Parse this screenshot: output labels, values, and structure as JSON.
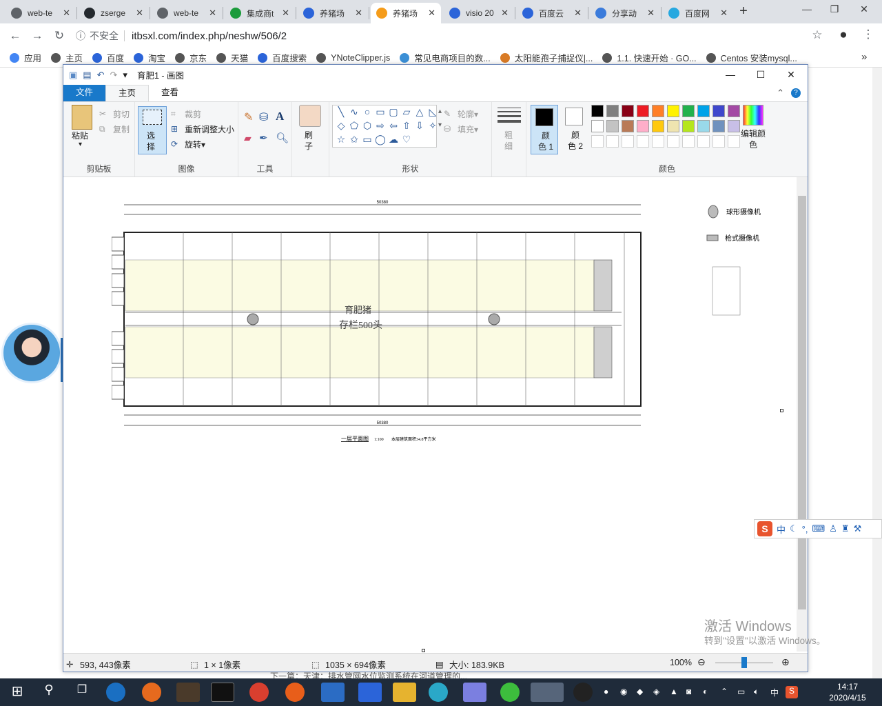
{
  "browser": {
    "tabs": [
      {
        "title": "web-te",
        "color": "#5f6368",
        "active": false
      },
      {
        "title": "zserge",
        "color": "#24292e",
        "active": false
      },
      {
        "title": "web-te",
        "color": "#5f6368",
        "active": false
      },
      {
        "title": "集成商t",
        "color": "#1b9b3b",
        "active": false
      },
      {
        "title": "养猪场",
        "color": "#2b64d9",
        "active": false
      },
      {
        "title": "养猪场",
        "color": "#f59c1a",
        "active": true,
        "prefix": "XL"
      },
      {
        "title": "visio 20",
        "color": "#2b64d9",
        "active": false
      },
      {
        "title": "百度云",
        "color": "#2b64d9",
        "active": false
      },
      {
        "title": "分享动",
        "color": "#3b7bdb",
        "active": false
      },
      {
        "title": "百度网",
        "color": "#26a8e0",
        "active": false
      }
    ],
    "insecure_label": "不安全",
    "url": "itbsxl.com/index.php/neshw/506/2",
    "bookmarks": [
      {
        "label": "应用",
        "color": "#4285f4"
      },
      {
        "label": "主页",
        "color": "#555"
      },
      {
        "label": "百度",
        "color": "#2b64d9"
      },
      {
        "label": "淘宝",
        "color": "#2b64d9"
      },
      {
        "label": "京东",
        "color": "#555"
      },
      {
        "label": "天猫",
        "color": "#555"
      },
      {
        "label": "百度搜索",
        "color": "#2b64d9"
      },
      {
        "label": "YNoteClipper.js",
        "color": "#555"
      },
      {
        "label": "常见电商项目的数...",
        "color": "#3b8fd6"
      },
      {
        "label": "太阳能孢子捕捉仪|...",
        "color": "#d97b26"
      },
      {
        "label": "1.1. 快速开始 · GO...",
        "color": "#555"
      },
      {
        "label": "Centos 安装mysql...",
        "color": "#555"
      }
    ]
  },
  "paint": {
    "title": "育肥1 - 画图",
    "tabs": {
      "file": "文件",
      "home": "主页",
      "view": "查看"
    },
    "clipboard": {
      "paste": "粘贴",
      "cut": "剪切",
      "copy": "复制",
      "group": "剪贴板"
    },
    "image": {
      "select": "选择",
      "crop": "裁剪",
      "resize": "重新调整大小",
      "rotate": "旋转",
      "group": "图像"
    },
    "tools": {
      "group": "工具"
    },
    "brush": {
      "label": "刷子"
    },
    "shapes": {
      "outline": "轮廓",
      "fill": "填充",
      "group": "形状"
    },
    "size": {
      "label": "粗细"
    },
    "colors": {
      "color1": "颜色 1",
      "color2": "颜色 2",
      "edit": "编辑颜色",
      "group": "颜色",
      "row1": [
        "#000000",
        "#7f7f7f",
        "#880015",
        "#ed1c24",
        "#ff7f27",
        "#fff200",
        "#22b14c",
        "#00a2e8",
        "#3f48cc",
        "#a349a4"
      ],
      "row2": [
        "#ffffff",
        "#c3c3c3",
        "#b97a57",
        "#ffaec9",
        "#ffc90e",
        "#efe4b0",
        "#b5e61d",
        "#99d9ea",
        "#7092be",
        "#c8bfe7"
      ]
    },
    "drawing": {
      "total_dim": "50380",
      "segments": [
        "5720",
        "4800",
        "4800",
        "4800",
        "4800",
        "4800",
        "4800",
        "4800",
        "4800",
        "4920",
        "640"
      ],
      "center_label": "育肥猪",
      "center_label2": "存栏500头",
      "legend_dome": "球形摄像机",
      "legend_bullet": "枪式摄像机",
      "plan_title": "一层平面图",
      "scale": "1:100",
      "area_note": "本层建筑面积34.8平方米"
    },
    "status": {
      "cursor": "593, 443像素",
      "selection": "1 × 1像素",
      "image_size": "1035 × 694像素",
      "file_size": "大小: 183.9KB",
      "zoom": "100%"
    }
  },
  "ime": {
    "lang": "中"
  },
  "watermark": {
    "line1": "激活 Windows",
    "line2": "转到\"设置\"以激活 Windows。"
  },
  "footer_link": "下一篇：天津：排水管网水位监测系统在河道管理的...",
  "clock": {
    "time": "14:17",
    "date": "2020/4/15"
  },
  "tray": {
    "lang": "中"
  }
}
